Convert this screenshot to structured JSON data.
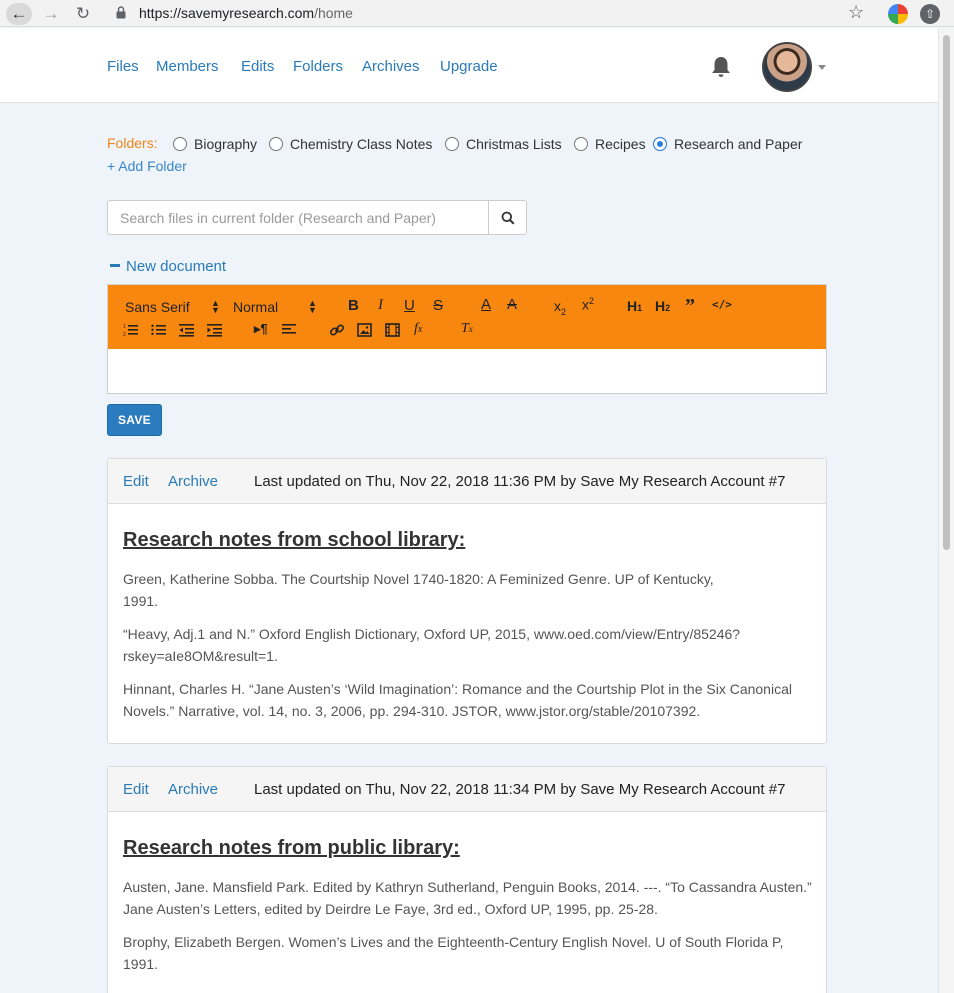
{
  "browser": {
    "url_host": "https://savemyresearch.com",
    "url_path": "/home"
  },
  "nav": {
    "links": [
      "Files",
      "Members",
      "Edits",
      "Folders",
      "Archives",
      "Upgrade"
    ]
  },
  "folders": {
    "label": "Folders:",
    "options": [
      "Biography",
      "Chemistry Class Notes",
      "Christmas Lists",
      "Recipes",
      "Research and Paper"
    ],
    "selected": "Research and Paper",
    "add_label": "+ Add Folder"
  },
  "search": {
    "placeholder": "Search files in current folder (Research and Paper)"
  },
  "new_document": "New document",
  "toolbar": {
    "font": "Sans Serif",
    "size": "Normal"
  },
  "save_label": "SAVE",
  "documents": [
    {
      "edit_label": "Edit",
      "archive_label": "Archive",
      "meta": "Last updated on Thu, Nov 22, 2018 11:36 PM by Save My Research Account #7",
      "title": "Research notes from school library:",
      "paragraphs": [
        "Green, Katherine Sobba. The Courtship Novel 1740-1820: A Feminized Genre. UP of Kentucky, 1991.",
        "“Heavy, Adj.1 and N.” Oxford English Dictionary, Oxford UP, 2015, www.oed.com/view/Entry/85246?rskey=aIe8OM&result=1.",
        "Hinnant, Charles H. “Jane Austen’s ‘Wild Imagination’: Romance and the Courtship Plot in the Six Canonical Novels.” Narrative, vol. 14, no. 3, 2006, pp. 294-310. JSTOR, www.jstor.org/stable/20107392."
      ]
    },
    {
      "edit_label": "Edit",
      "archive_label": "Archive",
      "meta": "Last updated on Thu, Nov 22, 2018 11:34 PM by Save My Research Account #7",
      "title": "Research notes from public library:",
      "paragraphs": [
        "Austen, Jane. Mansfield Park. Edited by Kathryn Sutherland, Penguin Books, 2014. ---. “To Cassandra Austen.” Jane Austen’s Letters, edited by Deirdre Le Faye, 3rd ed., Oxford UP, 1995, pp. 25-28.",
        "Brophy, Elizabeth Bergen. Women’s Lives and the Eighteenth-Century English Novel. U of South Florida P, 1991."
      ]
    }
  ]
}
